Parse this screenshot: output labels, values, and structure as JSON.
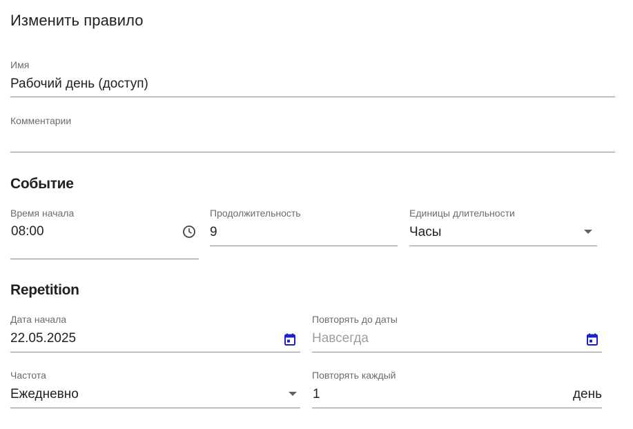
{
  "page": {
    "title": "Изменить правило"
  },
  "general": {
    "name": {
      "label": "Имя",
      "value": "Рабочий день (доступ)"
    },
    "comment": {
      "label": "Комментарии",
      "value": ""
    }
  },
  "event": {
    "heading": "Событие",
    "start_time": {
      "label": "Время начала",
      "value": "08:00",
      "icon": "clock-icon"
    },
    "duration": {
      "label": "Продолжительность",
      "value": "9"
    },
    "duration_units": {
      "label": "Единицы длительности",
      "value": "Часы",
      "icon": "dropdown-arrow-icon"
    }
  },
  "repetition": {
    "heading": "Repetition",
    "start_date": {
      "label": "Дата начала",
      "value": "22.05.2025",
      "icon": "calendar-icon"
    },
    "repeat_until": {
      "label": "Повторять до даты",
      "placeholder": "Навсегда",
      "icon": "calendar-icon"
    },
    "frequency": {
      "label": "Частота",
      "value": "Ежедневно",
      "icon": "dropdown-arrow-icon"
    },
    "repeat_every": {
      "label": "Повторять каждый",
      "value": "1",
      "suffix": "день"
    }
  },
  "colors": {
    "text": "#212121",
    "label": "#6b6b6b",
    "underline": "#8a8a8a",
    "calendar_icon": "#1a20c8",
    "icon": "#424242"
  }
}
